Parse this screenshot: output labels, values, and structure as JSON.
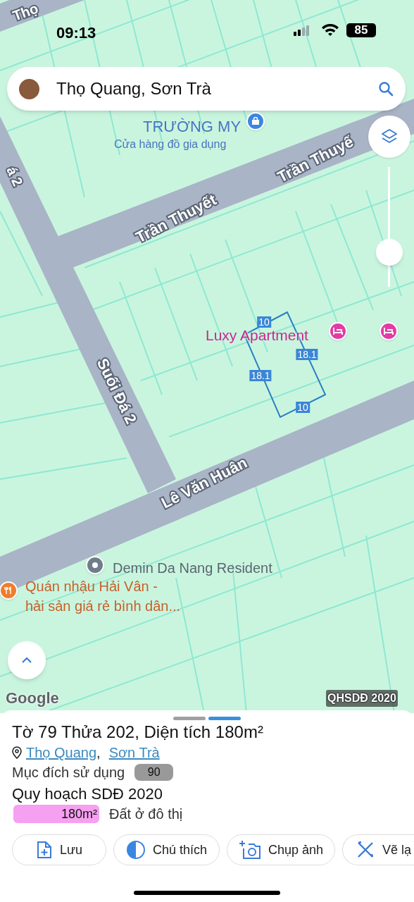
{
  "status_bar": {
    "time": "09:13",
    "battery": "85"
  },
  "search": {
    "value": "Thọ Quang, Sơn Trà"
  },
  "map": {
    "roads": [
      {
        "name": "Thọ"
      },
      {
        "name": "á 2"
      },
      {
        "name": "Trần Thuyế"
      },
      {
        "name": "Trần Thuyết"
      },
      {
        "name": "Suối Đá 2"
      },
      {
        "name": "Lê Văn Huân"
      }
    ],
    "places": [
      {
        "kind": "shop",
        "name": "TRƯỜNG MY",
        "subtitle": "Cửa hàng đồ gia dụng"
      },
      {
        "kind": "hotel",
        "name": "Luxy Apartment"
      },
      {
        "kind": "hotel"
      },
      {
        "kind": "place",
        "name": "Demin Da Nang Resident"
      },
      {
        "kind": "restaurant",
        "name": "Quán nhậu Hải Vân -",
        "subtitle": "hải sản giá rẻ bình dân..."
      }
    ],
    "parcel_edges": [
      "10",
      "18.1",
      "18.1",
      "10"
    ],
    "zoom_slider": {
      "level": 0.23
    },
    "attribution": "Google",
    "layer_label": "QHSDĐ 2020"
  },
  "sheet": {
    "pager": [
      {
        "selected": false
      },
      {
        "selected": true
      }
    ],
    "title": "Tờ 79 Thửa 202, Diện tích 180m²",
    "location": {
      "ward_link": "Thọ Quang",
      "separator": ",",
      "district_link": "Sơn Trà"
    },
    "usage_label": "Mục đích sử dụng",
    "usage_badge": "90",
    "plan_title": "Quy hoạch SDĐ 2020",
    "plan_rows": [
      {
        "area": "180m²",
        "label": "Đất ở đô thị",
        "color": "#f5a0f0"
      }
    ],
    "actions": [
      {
        "kind": "save",
        "label": "Lưu"
      },
      {
        "kind": "legend",
        "label": "Chú thích"
      },
      {
        "kind": "photo",
        "label": "Chụp ảnh"
      },
      {
        "kind": "redraw",
        "label": "Vẽ lạ"
      }
    ]
  }
}
